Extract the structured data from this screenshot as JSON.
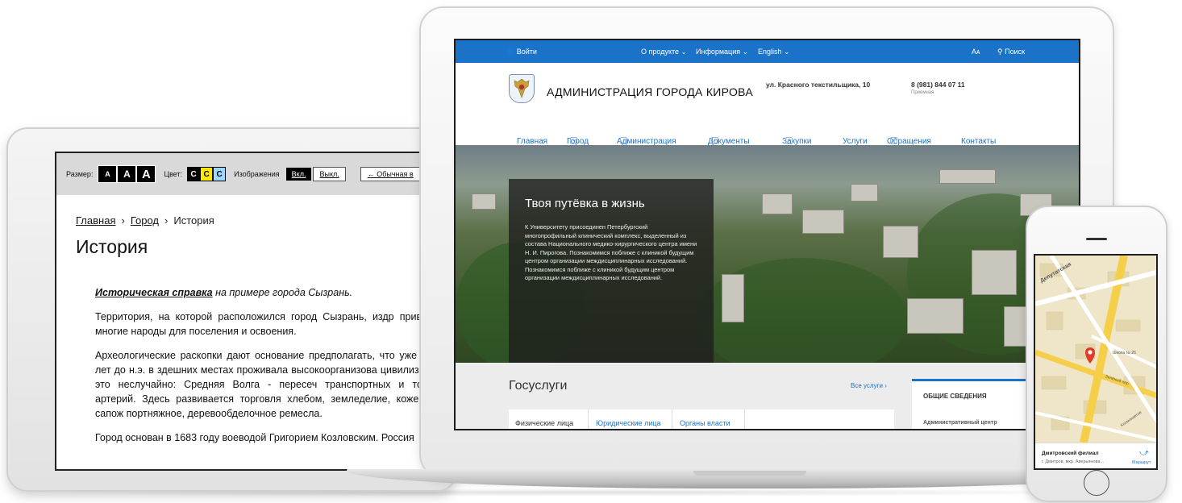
{
  "tablet": {
    "accessibility_bar": {
      "size_label": "Размер:",
      "size_buttons": [
        "A",
        "A",
        "A"
      ],
      "color_label": "Цвет:",
      "color_buttons": [
        "C",
        "C",
        "C"
      ],
      "images_label": "Изображения",
      "images_on": "Вкл.",
      "images_off": "Выкл.",
      "back_label": "← Обычная в"
    },
    "breadcrumb": [
      "Главная",
      "Город",
      "История"
    ],
    "breadcrumb_sep": "›",
    "title": "История",
    "lead_highlight": "Историческая справка",
    "lead_rest": " на примере города Сызрань.",
    "paragraphs": [
      "Территория, на которой расположился город Сызрань, издр привлекала многие народы для поселения и освоения.",
      "Археологические раскопки дают основание предполагать, что уже тысячи лет до н.э. в здешних местах проживала высокоорганизова цивилизация. И это неслучайно: Средняя Волга - пересеч транспортных и торговых артерий. Здесь развивается торговля хлебом, земледелие, кожевенное, сапож портняжное, деревообделочное ремесла.",
      "Город основан в 1683 году воеводой Григорием Козловским. Россия"
    ]
  },
  "laptop": {
    "topbar": {
      "login": "Войти",
      "nav": [
        "О продукте ⌄",
        "Информация ⌄",
        "English ⌄"
      ],
      "font_size_toggle": "Aᴀ",
      "search": "Поиск"
    },
    "header": {
      "org_name": "АДМИНИСТРАЦИЯ ГОРОДА КИРОВА",
      "address": "ул. Красного текстильщика, 10",
      "phone": "8 (981) 844 07 11",
      "phone_sub": "Приемная"
    },
    "main_nav": [
      {
        "label": "Главная",
        "dropdown": false
      },
      {
        "label": "Город",
        "dropdown": true
      },
      {
        "label": "Администрация",
        "dropdown": true
      },
      {
        "label": "Документы",
        "dropdown": true
      },
      {
        "label": "Закупки",
        "dropdown": true
      },
      {
        "label": "Услуги",
        "dropdown": false
      },
      {
        "label": "Обращения",
        "dropdown": true
      },
      {
        "label": "Контакты",
        "dropdown": false
      }
    ],
    "hero": {
      "title": "Твоя путёвка в жизнь",
      "text": "К Университету присоединен Петербургский многопрофильный клинический комплекс, выделенный из состава Национального медико-хирургического центра имени Н. И. Пирогова. Познакомимся поближе с клиникой будущим центром организации междисциплинарных исследований. Познакомимся поближе с клиникой будущим центром организации междисциплинарных исследований."
    },
    "gos": {
      "title": "Госуслуги",
      "all_link": "Все услуги ›",
      "tabs": [
        "Физические лица",
        "Юридические лица",
        "Органы власти"
      ],
      "info_title": "ОБЩИЕ СВЕДЕНИЯ",
      "info_sub": "Административный центр"
    },
    "colors": {
      "accent": "#1a73c9"
    }
  },
  "phone": {
    "map_labels": [
      "Депутатская",
      "Школа № 26",
      "Зелёный пер.",
      "Космонавтов"
    ],
    "card_title": "Дмитровский филиал",
    "card_address": "г. Дмитров, мкр. Аверьянова...",
    "route_label": "Маршрут",
    "icons": [
      "map-pin-icon",
      "route-icon"
    ]
  }
}
